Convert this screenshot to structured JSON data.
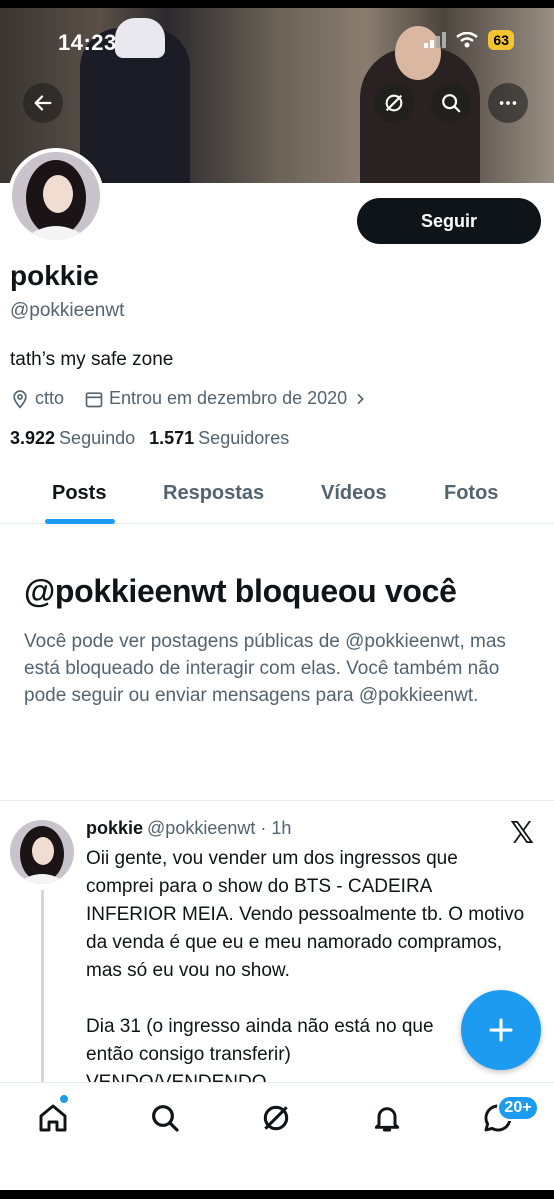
{
  "status_bar": {
    "time": "14:23",
    "battery": "63"
  },
  "profile": {
    "display_name": "pokkie",
    "handle": "@pokkieenwt",
    "bio": "tath’s my safe zone",
    "location": "ctto",
    "joined": "Entrou em dezembro de 2020",
    "following_count": "3.922",
    "following_label": "Seguindo",
    "followers_count": "1.571",
    "followers_label": "Seguidores",
    "follow_button": "Seguir"
  },
  "tabs": [
    {
      "label": "Posts",
      "active": true
    },
    {
      "label": "Respostas"
    },
    {
      "label": "Vídeos"
    },
    {
      "label": "Fotos"
    }
  ],
  "blocked": {
    "title": "@pokkieenwt bloqueou você",
    "text": "Você pode ver postagens públicas de @pokkieenwt, mas está bloqueado de interagir com elas. Você também não pode seguir ou enviar mensagens para @pokkieenwt."
  },
  "tweet": {
    "name": "pokkie",
    "handle_time": "@pokkieenwt · 1h",
    "body": "Oii gente, vou vender um dos ingressos que comprei para o show do BTS - CADEIRA INFERIOR MEIA. Vendo pessoalmente tb. O motivo da venda é que eu e meu namorado compramos, mas só eu vou no show.\n\nDia 31 (o ingresso ainda não está no que\nentão consigo transferir)\nVENDO/VENDENDO"
  },
  "nav": {
    "messages_badge": "20+"
  },
  "colors": {
    "accent": "#1d9bf0",
    "text": "#0f1419",
    "muted": "#536471"
  },
  "icons": [
    "back-arrow-icon",
    "grok-icon",
    "search-icon",
    "more-icon",
    "location-icon",
    "calendar-icon",
    "chevron-right-icon",
    "x-logo-icon",
    "plus-icon",
    "home-icon",
    "explore-icon",
    "grok-icon",
    "notifications-icon",
    "messages-icon"
  ]
}
